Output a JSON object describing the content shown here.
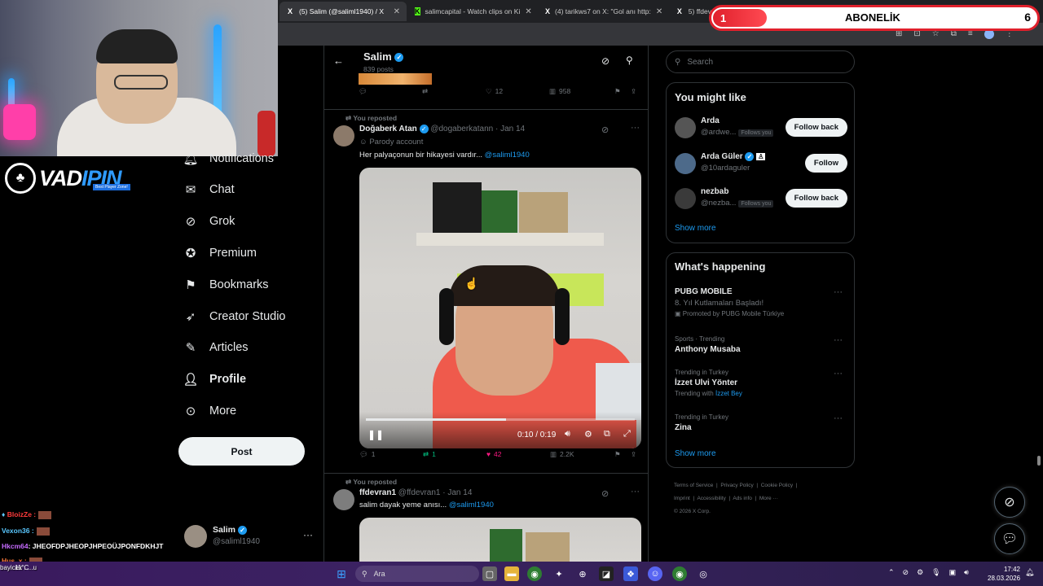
{
  "browser": {
    "tabs": [
      {
        "icon": "X",
        "title": "(5) Salim (@saliml1940) / X"
      },
      {
        "icon": "K",
        "title": "salimcapital - Watch clips on Ki"
      },
      {
        "icon": "X",
        "title": "(4) tarikws7 on X: \"Gol anı http:"
      },
      {
        "icon": "X",
        "title": "5) ffdev"
      }
    ],
    "new_tab": "+"
  },
  "stream": {
    "logo_text_left": "VAD",
    "logo_text_right": "IPIN",
    "logo_tagline": "Best Player Zone!",
    "abonelik": {
      "current": "1",
      "label": "ABONELİK",
      "goal": "6"
    },
    "chat": [
      {
        "user": "BloizZe :",
        "color": "#ff3b3b",
        "text": ""
      },
      {
        "user": "Vexon36 :",
        "color": "#5ac8ff",
        "text": ""
      },
      {
        "user": "Hkcm64",
        "color": "#c66bff",
        "text": ": JHEOFDPJHEOPJHPEOÜJPONFDKHJT"
      },
      {
        "user": "Hus_x :",
        "color": "#ff7a3b",
        "text": ""
      },
      {
        "user": "bayicek :",
        "color": "#ffffff",
        "text": "...u"
      }
    ]
  },
  "nav": {
    "items": [
      {
        "label": "Notifications",
        "icon": "bell-icon"
      },
      {
        "label": "Chat",
        "icon": "mail-icon"
      },
      {
        "label": "Grok",
        "icon": "grok-icon"
      },
      {
        "label": "Premium",
        "icon": "verified-icon"
      },
      {
        "label": "Bookmarks",
        "icon": "bookmark-icon"
      },
      {
        "label": "Creator Studio",
        "icon": "rocket-icon"
      },
      {
        "label": "Articles",
        "icon": "article-icon"
      },
      {
        "label": "Profile",
        "icon": "person-icon"
      },
      {
        "label": "More",
        "icon": "more-icon"
      }
    ],
    "post_button": "Post",
    "account": {
      "name": "Salim",
      "handle": "@saliml1940"
    }
  },
  "profile_header": {
    "name": "Salim",
    "posts": "839 posts"
  },
  "feed": {
    "prev_post_stats": {
      "replies": "",
      "reposts": "",
      "likes": "12",
      "views": "958"
    },
    "posts": [
      {
        "context": "You reposted",
        "author": "Doğaberk Atan",
        "handle": "@dogaberkatann",
        "date": "· Jan 14",
        "badge": "Parody account",
        "text": "Her palyaçonun bir hikayesi vardır...",
        "mention": "@saliml1940",
        "video": {
          "time": "0:10 / 0:19",
          "progress": 0.52
        },
        "stats": {
          "replies": "1",
          "reposts": "1",
          "likes": "42",
          "views": "2.2K"
        }
      },
      {
        "context": "You reposted",
        "author": "ffdevran1",
        "handle": "@ffdevran1",
        "date": "· Jan 14",
        "text": "salim dayak yeme anısı...",
        "mention": "@saliml1940"
      }
    ]
  },
  "search": {
    "placeholder": "Search"
  },
  "you_might_like": {
    "title": "You might like",
    "users": [
      {
        "name": "Arda",
        "handle": "@ardwe...",
        "follows_you": "Follows you",
        "button": "Follow back"
      },
      {
        "name": "Arda Güler",
        "handle": "@10ardaguler",
        "follows_you": "",
        "button": "Follow"
      },
      {
        "name": "nezbab",
        "handle": "@nezba...",
        "follows_you": "Follows you",
        "button": "Follow back"
      }
    ],
    "show_more": "Show more"
  },
  "whats_happening": {
    "title": "What's happening",
    "trends": [
      {
        "category": "",
        "name": "PUBG MOBILE",
        "sub": "8. Yıl Kutlamaları Başladı!",
        "extra": "Promoted by PUBG Mobile Türkiye"
      },
      {
        "category": "Sports · Trending",
        "name": "Anthony Musaba",
        "sub": "",
        "extra": ""
      },
      {
        "category": "Trending in Turkey",
        "name": "İzzet Ulvi Yönter",
        "sub": "Trending with",
        "extra": "İzzet Bey"
      },
      {
        "category": "Trending in Turkey",
        "name": "Zina",
        "sub": "",
        "extra": ""
      }
    ],
    "show_more": "Show more"
  },
  "footer": {
    "links": [
      "Terms of Service",
      "Privacy Policy",
      "Cookie Policy",
      "Imprint",
      "Accessibility",
      "Ads info",
      "More ···"
    ],
    "copyright": "© 2026 X Corp."
  },
  "taskbar": {
    "search": "Ara",
    "time": "17:42",
    "date": "28.03.2026",
    "weather": "11°C"
  }
}
